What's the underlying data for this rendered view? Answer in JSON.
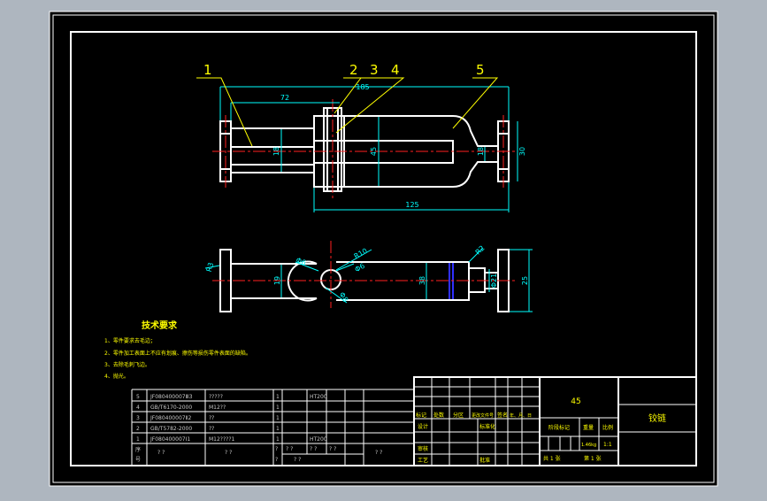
{
  "colors": {
    "viewport_bg": "#aeb6bf",
    "sheet_bg": "#000000",
    "outline": "#ffffff",
    "dimension": "#00ffff",
    "centerline": "#ff2020",
    "leader": "#ffff00",
    "callout": "#ffff00",
    "hidden": "#3030ff",
    "tech_text": "#ffff00",
    "table_text": "#ffff00",
    "bom_text": "#c8c8c8"
  },
  "drawing": {
    "callouts": [
      "1",
      "2",
      "3",
      "4",
      "5"
    ],
    "front_view_dims": {
      "overall": "185",
      "left": "72",
      "inner": "125",
      "h_left": "18",
      "h_mid": "45",
      "h_right": "18",
      "h_flange": "30"
    },
    "top_view_dims": {
      "d_left": "19",
      "d_mid": "38",
      "radius": "R10",
      "hole": "Φ6",
      "d_flange": "Φ21",
      "d_end": "25",
      "r_small": "R2",
      "angle_left": "R3",
      "small_a": "Φ6",
      "small_b": "Φ8"
    }
  },
  "tech_requirements": {
    "title": "技术要求",
    "items": [
      "1、零件要求去毛边；",
      "2、零件加工表面上不应有划痕、擦伤等损伤零件表面的缺陷。",
      "3、去除毛刺飞边。",
      "4、抛光。"
    ]
  },
  "bom": {
    "rows": [
      [
        "5",
        "JF080400007Ⅲ3",
        "?????",
        "1",
        "",
        "HT200"
      ],
      [
        "4",
        "GB/T6170-2000",
        "M12??",
        "1",
        "",
        ""
      ],
      [
        "3",
        "JF080400007Ⅱ2",
        "??",
        "1",
        "",
        ""
      ],
      [
        "2",
        "GB/T5782-2000",
        "??",
        "1",
        "",
        ""
      ],
      [
        "1",
        "JF080400007Ⅰ1",
        "M12????1",
        "1",
        "",
        "HT200"
      ]
    ],
    "header": {
      "seq_a": "序",
      "seq_b": "号",
      "c1": "? ?",
      "c2": "? ?",
      "c3_top": "?",
      "c3_bot": "?",
      "c4_top": "? ?",
      "c4_bot": "? ?",
      "c5_top": "? ?",
      "c5_mid": "? ?",
      "c6": "? ?"
    }
  },
  "title_block": {
    "material": "45",
    "part_name": "铰链",
    "rev_headers": [
      "标记",
      "处数",
      "分区",
      "更改文件号",
      "签名",
      "年、月、日"
    ],
    "design": "设计",
    "standardize": "标准化",
    "review": "审核",
    "process": "工艺",
    "approve": "批准",
    "stage_mark": "阶段标记",
    "weight": "重量",
    "scale": "比例",
    "weight_val": "1.46kg",
    "scale_val": "1:1",
    "total_sheets": "共 1 张",
    "sheet_no": "第 1 张"
  }
}
